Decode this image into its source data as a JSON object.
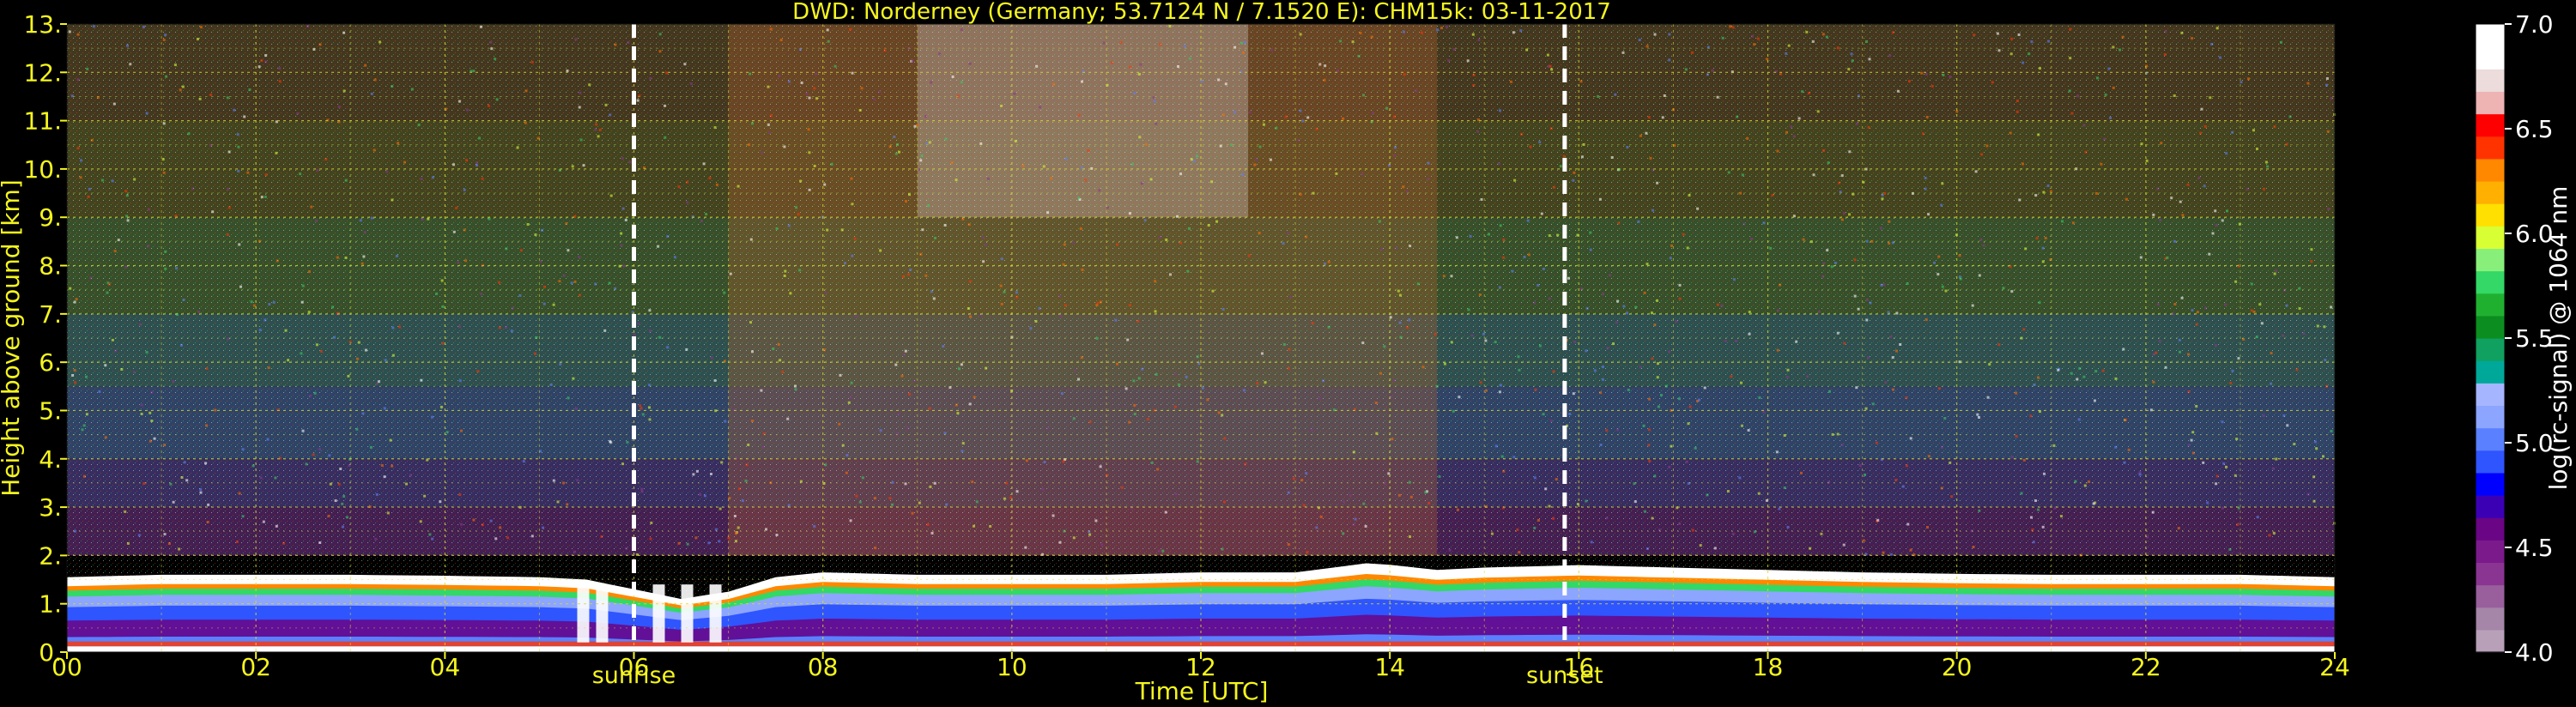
{
  "chart_data": {
    "type": "heatmap",
    "title": "DWD: Norderney (Germany; 53.7124 N / 7.1520 E):    CHM15k: 03-11-2017",
    "xlabel": "Time [UTC]",
    "ylabel": "Height above ground [km]",
    "xlim": [
      0,
      24
    ],
    "ylim": [
      0,
      13
    ],
    "x_ticks": [
      0,
      2,
      4,
      6,
      8,
      10,
      12,
      14,
      16,
      18,
      20,
      22,
      24
    ],
    "x_tick_labels": [
      "00",
      "02",
      "04",
      "06",
      "08",
      "10",
      "12",
      "14",
      "16",
      "18",
      "20",
      "22",
      "24"
    ],
    "y_ticks": [
      0,
      1,
      2,
      3,
      4,
      5,
      6,
      7,
      8,
      9,
      10,
      11,
      12,
      13
    ],
    "y_tick_labels": [
      "0.",
      "1.",
      "2.",
      "3.",
      "4.",
      "5.",
      "6.",
      "7.",
      "8.",
      "9.",
      "10.",
      "11.",
      "12.",
      "13."
    ],
    "grid": true,
    "events": [
      {
        "name": "sunrise",
        "time": 6.0
      },
      {
        "name": "sunset",
        "time": 15.85
      }
    ],
    "boundary_layer_top_km": [
      {
        "time": 0.0,
        "height": 1.55
      },
      {
        "time": 1.0,
        "height": 1.6
      },
      {
        "time": 2.0,
        "height": 1.6
      },
      {
        "time": 3.0,
        "height": 1.6
      },
      {
        "time": 4.0,
        "height": 1.58
      },
      {
        "time": 5.0,
        "height": 1.55
      },
      {
        "time": 5.5,
        "height": 1.5
      },
      {
        "time": 6.0,
        "height": 1.3
      },
      {
        "time": 6.5,
        "height": 1.1
      },
      {
        "time": 7.0,
        "height": 1.25
      },
      {
        "time": 7.5,
        "height": 1.55
      },
      {
        "time": 8.0,
        "height": 1.65
      },
      {
        "time": 9.0,
        "height": 1.6
      },
      {
        "time": 10.0,
        "height": 1.6
      },
      {
        "time": 11.0,
        "height": 1.6
      },
      {
        "time": 12.0,
        "height": 1.65
      },
      {
        "time": 13.0,
        "height": 1.65
      },
      {
        "time": 13.8,
        "height": 1.85
      },
      {
        "time": 14.5,
        "height": 1.7
      },
      {
        "time": 15.0,
        "height": 1.75
      },
      {
        "time": 16.0,
        "height": 1.8
      },
      {
        "time": 17.0,
        "height": 1.75
      },
      {
        "time": 18.0,
        "height": 1.7
      },
      {
        "time": 19.0,
        "height": 1.65
      },
      {
        "time": 20.0,
        "height": 1.62
      },
      {
        "time": 21.0,
        "height": 1.6
      },
      {
        "time": 22.0,
        "height": 1.6
      },
      {
        "time": 23.0,
        "height": 1.6
      },
      {
        "time": 24.0,
        "height": 1.55
      }
    ],
    "colorbar": {
      "label": "log(rc-signal) @ 1064 nm",
      "range": [
        4.0,
        7.0
      ],
      "ticks": [
        4.0,
        4.5,
        5.0,
        5.5,
        6.0,
        6.5,
        7.0
      ],
      "tick_labels": [
        "4.0",
        "4.5",
        "5.0",
        "5.5",
        "6.0",
        "6.5",
        "7.0"
      ],
      "colors": [
        "#b8a0b8",
        "#a585a8",
        "#985f9c",
        "#8a3592",
        "#7b1a8a",
        "#6a0585",
        "#3c00b4",
        "#0000ff",
        "#2f55ff",
        "#5a80ff",
        "#8ca5ff",
        "#a5b5ff",
        "#00a899",
        "#10a060",
        "#0c8d20",
        "#20b030",
        "#33d866",
        "#88f07a",
        "#d8ff33",
        "#ffe000",
        "#ffb000",
        "#ff8800",
        "#ff3300",
        "#ff0000",
        "#eeb3b3",
        "#ecdcdc",
        "#ffffff",
        "#ffffff"
      ]
    }
  }
}
